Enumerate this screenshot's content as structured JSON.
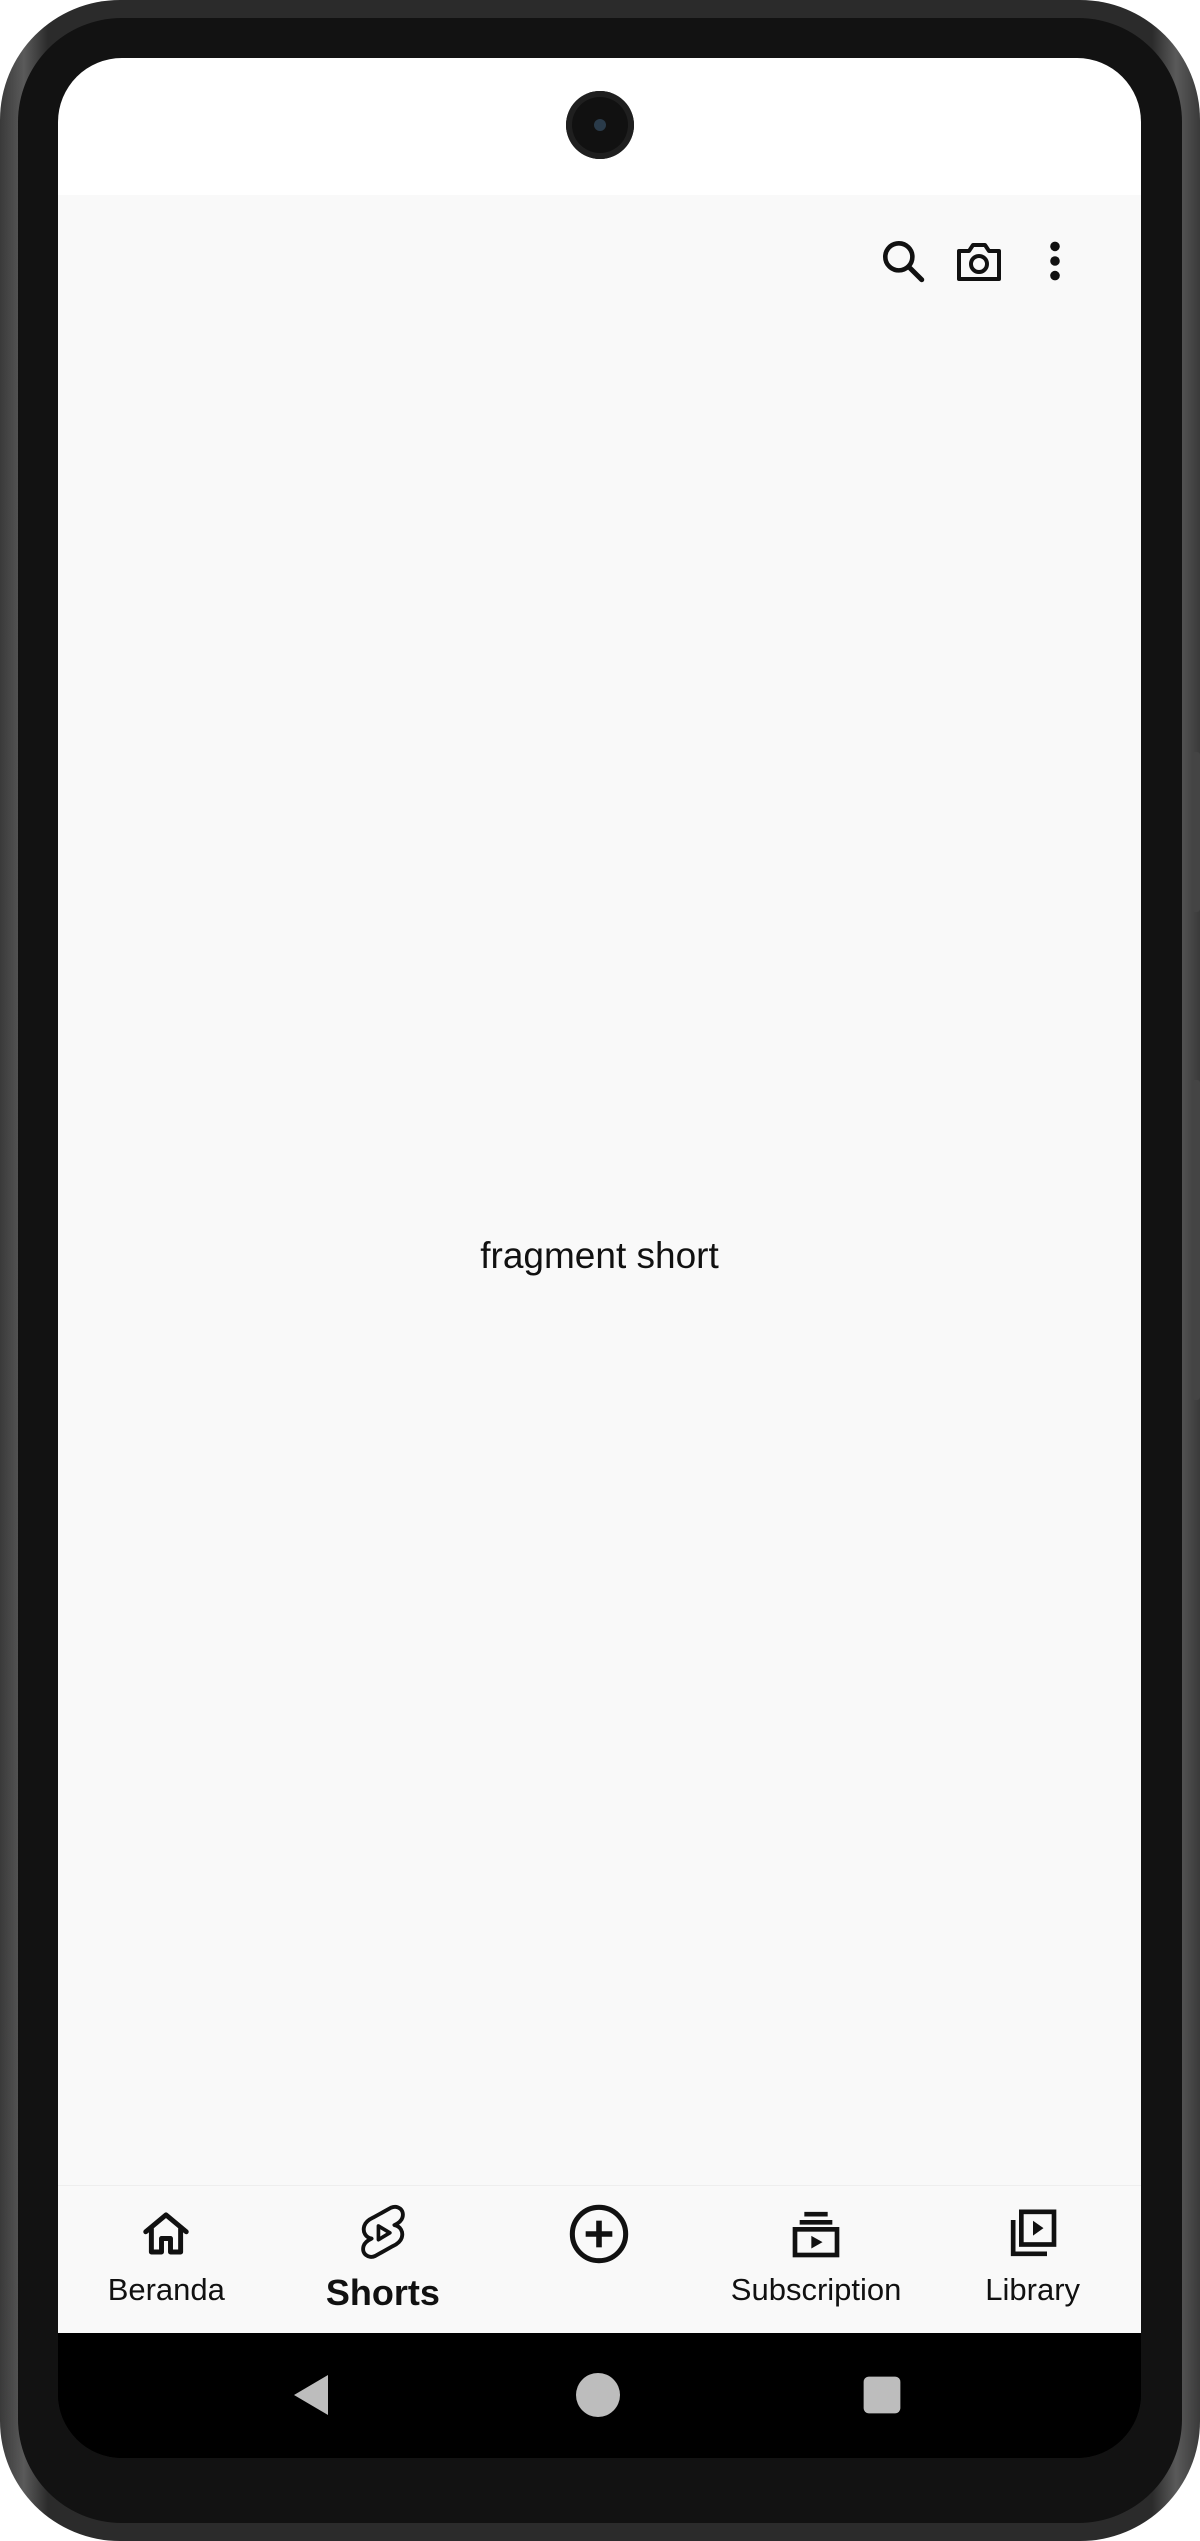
{
  "app": {
    "content_text": "fragment short",
    "toolbar": {
      "icons": [
        "search-icon",
        "camera-icon",
        "more-vert-icon"
      ]
    }
  },
  "bottom_nav": {
    "items": [
      {
        "label": "Beranda",
        "icon": "home-icon",
        "active": false
      },
      {
        "label": "Shorts",
        "icon": "shorts-icon",
        "active": true
      },
      {
        "label": "",
        "icon": "add-circle-icon",
        "active": false
      },
      {
        "label": "Subscription",
        "icon": "subscriptions-icon",
        "active": false
      },
      {
        "label": "Library",
        "icon": "library-icon",
        "active": false
      }
    ]
  },
  "system_nav": {
    "icons": [
      "back-icon",
      "home-circle-icon",
      "recents-icon"
    ]
  }
}
